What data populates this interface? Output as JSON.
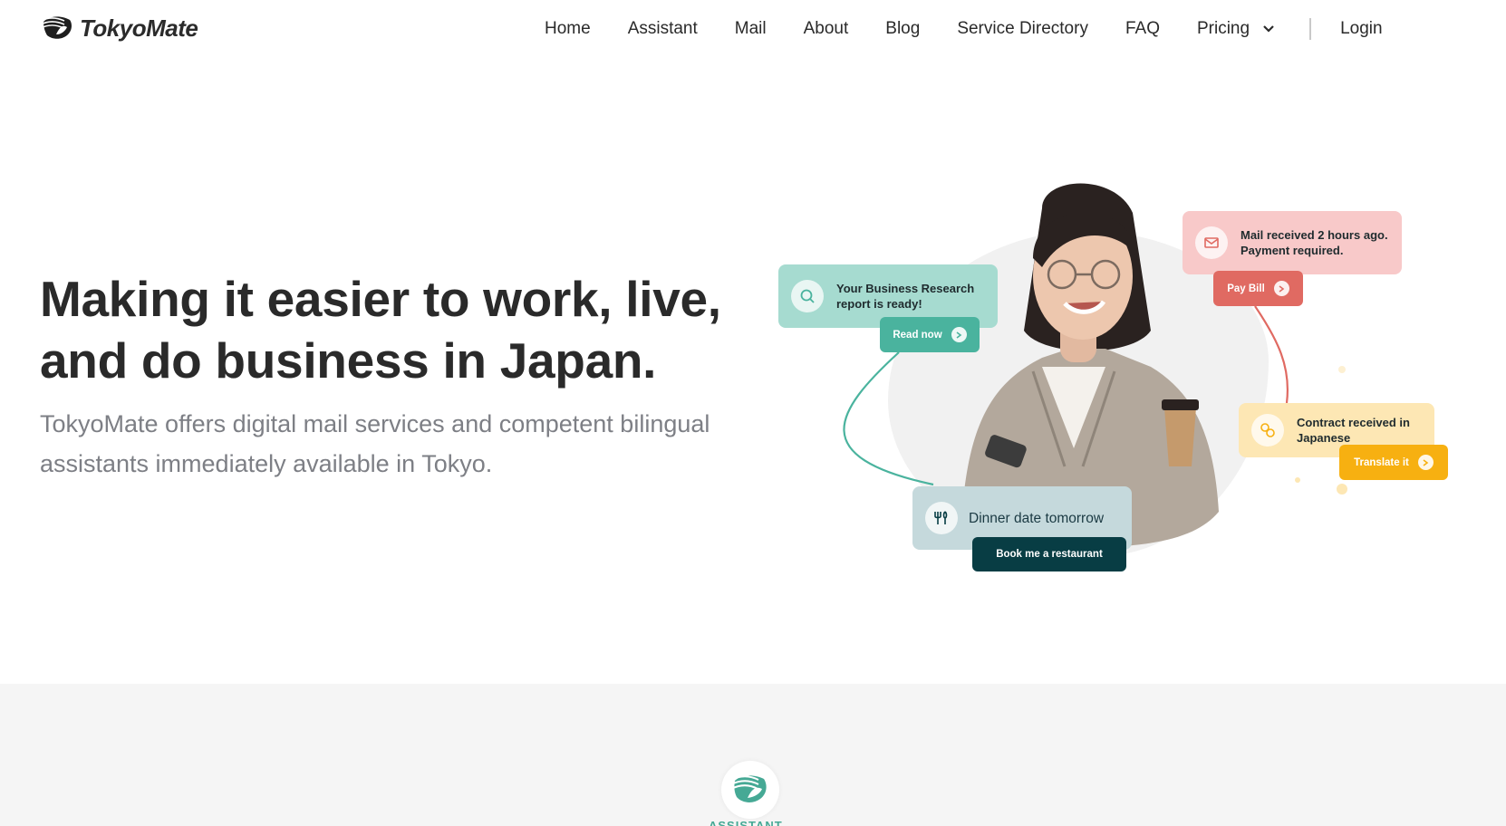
{
  "brand": {
    "name": "TokyoMate",
    "logo_icon": "wave-logo-icon"
  },
  "nav": {
    "items": [
      "Home",
      "Assistant",
      "Mail",
      "About",
      "Blog",
      "Service Directory",
      "FAQ"
    ],
    "pricing": "Pricing",
    "login": "Login"
  },
  "hero": {
    "title": "Making it easier to work, live, and do business in Japan.",
    "subtitle": "TokyoMate offers digital mail services and competent bilingual assistants immediately available in Tokyo."
  },
  "cards": {
    "research": {
      "text": "Your Business Research report is ready!",
      "button": "Read now",
      "icon": "magnifier-chat-icon"
    },
    "mail": {
      "text": "Mail received 2 hours ago. Payment required.",
      "button": "Pay Bill",
      "icon": "envelope-icon"
    },
    "contract": {
      "text": "Contract received in Japanese",
      "button": "Translate it",
      "icon": "translate-icon"
    },
    "dinner": {
      "text": "Dinner date tomorrow",
      "button": "Book me a restaurant",
      "icon": "utensils-icon"
    }
  },
  "section2": {
    "label": "ASSISTANT",
    "icon": "assistant-wave-icon"
  },
  "colors": {
    "teal": "#4ab39e",
    "teal_light": "#a6dbd0",
    "coral": "#e06a62",
    "pink_light": "#f8c9c9",
    "amber": "#f7b011",
    "amber_light": "#fde7b4",
    "dark_teal": "#083d44",
    "slate_light": "#c5d9dc",
    "text_dark": "#2a2a2a",
    "text_muted": "#7d7f85"
  }
}
